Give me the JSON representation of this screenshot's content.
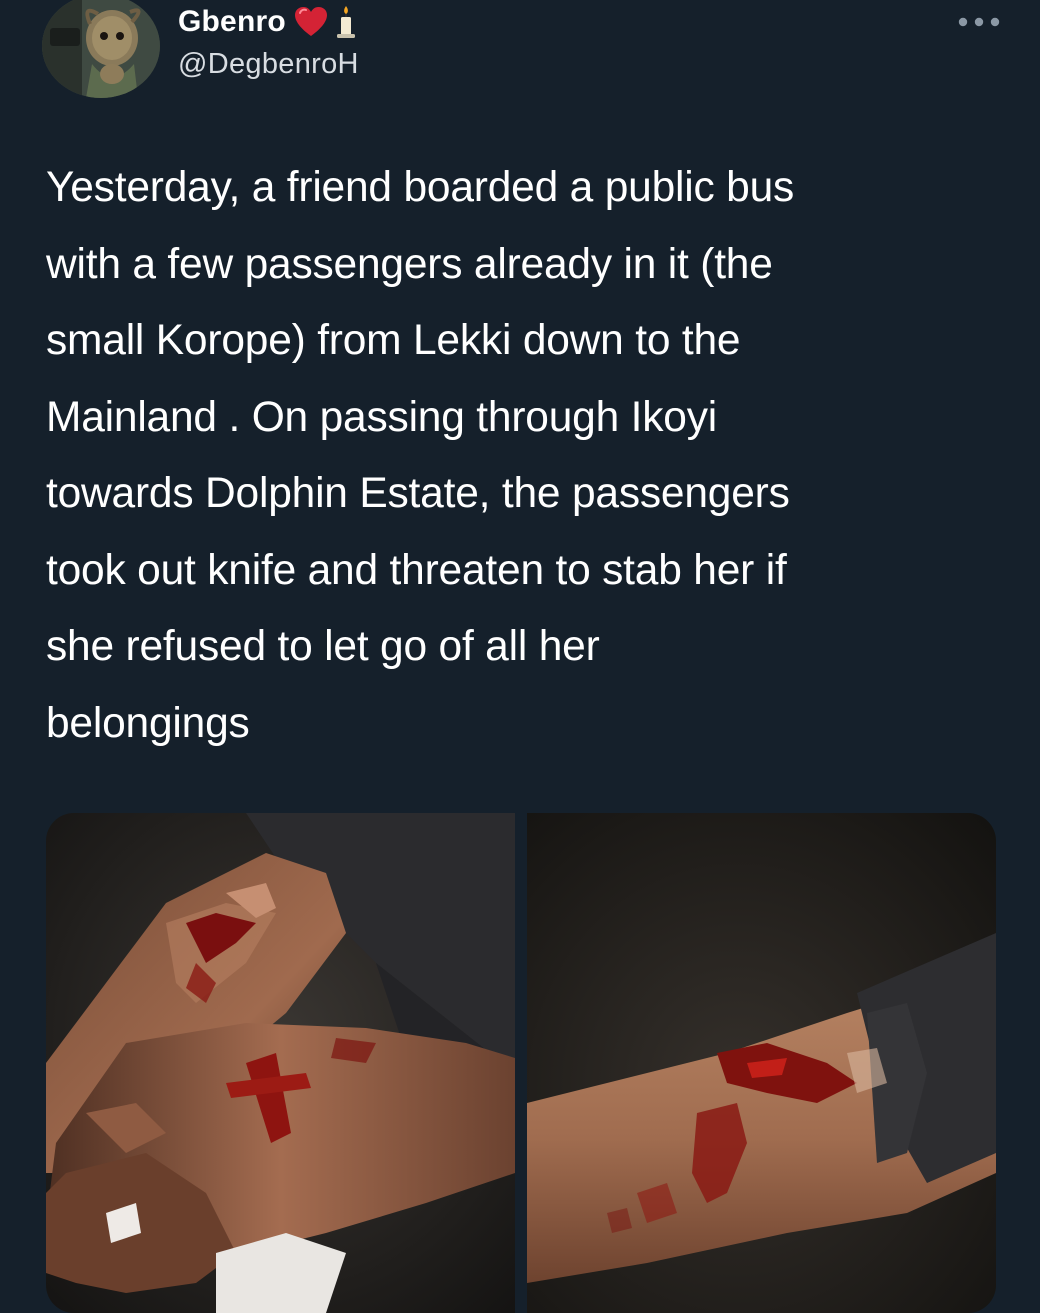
{
  "tweet": {
    "author": {
      "display_name": "Gbenro",
      "handle": "@DegbenroH",
      "name_emojis": [
        "heart-icon",
        "candle-icon"
      ]
    },
    "more_options_icon": "ellipsis-icon",
    "text": "Yesterday, a friend boarded a public bus with a few passengers already in it (the small Korope) from Lekki down to the Mainland . On passing through Ikoyi towards Dolphin Estate, the passengers took out knife and threaten to stab her if she refused to let go of all her belongings",
    "text_lines": [
      "Yesterday, a friend boarded a public bus",
      "with a few passengers already in it (the",
      "small Korope) from Lekki down to the",
      "Mainland . On passing through Ikoyi",
      "towards Dolphin Estate, the passengers",
      "took out knife and threaten to stab her if",
      "she refused to let go of all her",
      "belongings"
    ],
    "media_count": 2
  },
  "colors": {
    "background": "#15202b",
    "text": "#ffffff",
    "secondary_text": "#d8dde2",
    "heart": "#e0245e"
  }
}
